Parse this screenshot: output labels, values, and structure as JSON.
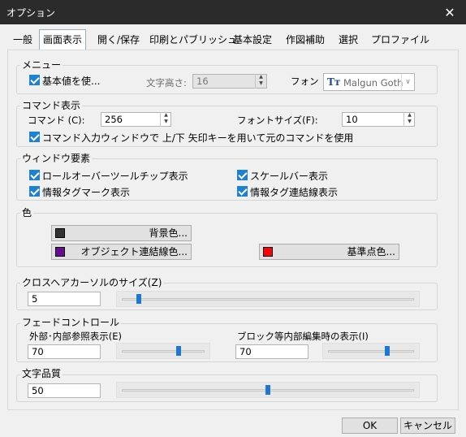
{
  "window": {
    "title": "オプション"
  },
  "tabs": [
    "一般",
    "画面表示",
    "開く/保存",
    "印刷とパブリッシュ",
    "基本設定",
    "作図補助",
    "選択",
    "プロファイル"
  ],
  "menu_group": {
    "label": "メニュー",
    "default_checkbox_label": "基本値を使...",
    "text_height_label": "文字高さ:",
    "text_height_value": "16",
    "font_label": "フォン",
    "font_value": "Malgun Goth",
    "font_icon": "Tт"
  },
  "command_group": {
    "label": "コマンド表示",
    "command_label": "コマンド (C):",
    "command_value": "256",
    "font_size_label": "フォントサイズ(F):",
    "font_size_value": "10",
    "arrow_keys_label": "コマンド入力ウィンドウで 上/下 矢印キーを用いて元のコマンドを使用"
  },
  "window_elements_group": {
    "label": "ウィンドウ要素",
    "rollover_tooltip": "ロールオーバーツールチップ表示",
    "scale_bar": "スケールバー表示",
    "info_tag_mark": "情報タグマーク表示",
    "info_tag_link": "情報タグ連結線表示"
  },
  "color_group": {
    "label": "色",
    "background_label": "背景色...",
    "object_link_label": "オブジェクト連結線色...",
    "base_point_label": "基準点色...",
    "colors": {
      "background": "#333333",
      "object_link": "#6a0a96",
      "base_point": "#ff0000"
    }
  },
  "crosshair_group": {
    "label": "クロスヘアカーソルのサイズ(Z)",
    "value": "5",
    "level_percent": 5
  },
  "fade_group": {
    "label": "フェードコントロール",
    "xref_label": "外部･内部参照表示(E)",
    "xref_value": "70",
    "xref_level_percent": 70,
    "block_label": "ブロック等内部編集時の表示(I)",
    "block_value": "70",
    "block_level_percent": 70
  },
  "text_quality_group": {
    "label": "文字品質",
    "value": "50",
    "level_percent": 50
  },
  "footer": {
    "ok": "OK",
    "cancel": "キャンセル"
  }
}
